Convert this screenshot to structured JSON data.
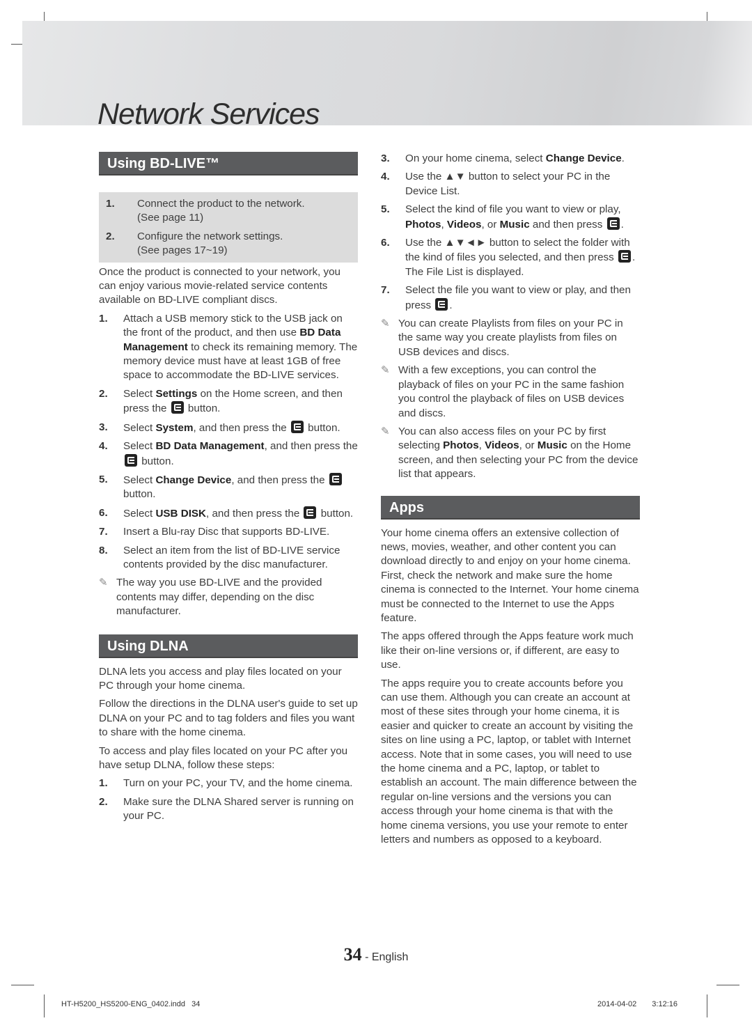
{
  "header": {
    "title": "Network Services"
  },
  "bdlive": {
    "heading": "Using BD-LIVE™",
    "prereq": [
      {
        "num": "1.",
        "text": "Connect the product to the network.",
        "sub": "(See page 11)"
      },
      {
        "num": "2.",
        "text": "Configure the network settings.",
        "sub": "(See pages 17~19)"
      }
    ],
    "intro": "Once the product is connected to your network, you can enjoy various movie-related service contents available on BD-LIVE compliant discs.",
    "steps": [
      {
        "num": "1.",
        "a": "Attach a USB memory stick to the USB jack on the front of the product, and then use ",
        "b": "BD Data Management",
        "c": " to check its remaining memory. The memory device must have at least 1GB of free space to accommodate the BD-LIVE services."
      },
      {
        "num": "2.",
        "a": "Select ",
        "b": "Settings",
        "c": " on the Home screen, and then press the ",
        "d": " button."
      },
      {
        "num": "3.",
        "a": "Select ",
        "b": "System",
        "c": ", and then press the ",
        "d": " button."
      },
      {
        "num": "4.",
        "a": "Select ",
        "b": "BD Data Management",
        "c": ", and then press the ",
        "d": " button."
      },
      {
        "num": "5.",
        "a": "Select ",
        "b": "Change Device",
        "c": ", and then press the ",
        "d": " button."
      },
      {
        "num": "6.",
        "a": "Select ",
        "b": "USB DISK",
        "c": ", and then press the ",
        "d": " button."
      },
      {
        "num": "7.",
        "a": "Insert a Blu-ray Disc that supports BD-LIVE."
      },
      {
        "num": "8.",
        "a": "Select an item from the list of BD-LIVE service contents provided by the disc manufacturer."
      }
    ],
    "note": "The way you use BD-LIVE and the provided contents may differ, depending on the disc manufacturer."
  },
  "dlna": {
    "heading": "Using DLNA",
    "paras": [
      "DLNA lets you access and play files located on your PC through your home cinema.",
      "Follow the directions in the DLNA user's guide to set up DLNA on your PC and to tag folders and files you want to share with the home cinema.",
      "To access and play files located on your PC after you have setup DLNA, follow these steps:"
    ],
    "steps": [
      {
        "num": "1.",
        "a": "Turn on your PC, your TV, and the home cinema."
      },
      {
        "num": "2.",
        "a": "Make sure the DLNA Shared server is running on your PC."
      },
      {
        "num": "3.",
        "a": "On your home cinema, select ",
        "b": "Change Device",
        "c": "."
      },
      {
        "num": "4.",
        "a": "Use the ▲▼ button to select your PC in the Device List."
      },
      {
        "num": "5.",
        "a": "Select the kind of file you want to view or play, ",
        "b1": "Photos",
        "s1": ", ",
        "b2": "Videos",
        "s2": ", or ",
        "b3": "Music",
        "c": " and then press "
      },
      {
        "num": "6.",
        "a": "Use the ▲▼◄► button to select the folder with the kind of files you selected, and then press ",
        "c": ". The File List is displayed."
      },
      {
        "num": "7.",
        "a": "Select the file you want to view or play, and then press ",
        "c": "."
      }
    ],
    "notes": [
      {
        "a": "You can create Playlists from files on your PC in the same way you create playlists from files on USB devices and discs."
      },
      {
        "a": "With a few exceptions, you can control the playback of files on your PC in the same fashion you control the playback of files on USB devices and discs."
      },
      {
        "a": "You can also access files on your PC by first selecting ",
        "b1": "Photos",
        "s1": ", ",
        "b2": "Videos",
        "s2": ", or ",
        "b3": "Music",
        "c": " on the Home screen, and then selecting your PC from the device list that appears."
      }
    ]
  },
  "apps": {
    "heading": "Apps",
    "paras": [
      "Your home cinema offers an extensive collection of news, movies, weather, and other content you can download directly to and enjoy on your home cinema. First, check the network and make sure the home cinema is connected to the Internet. Your home cinema must be connected to the Internet to use the Apps feature.",
      "The apps offered through the Apps feature work much like their on-line versions or, if different, are easy to use.",
      "The apps require you to create accounts before you can use them. Although you can create an account at most of these sites through your home cinema, it is easier and quicker to create an account by visiting the sites on line using a PC, laptop, or tablet with Internet access. Note that in some cases, you will need to use the home cinema and a PC, laptop, or tablet to establish an account. The main difference between the regular on-line versions and the versions you can access through your home cinema is that with the home cinema versions, you use your remote to enter letters and numbers as opposed to a keyboard."
    ]
  },
  "footer": {
    "page_number": "34",
    "page_lang": " - English",
    "file": "HT-H5200_HS5200-ENG_0402.indd   34",
    "date": "2014-04-02",
    "time": "3:12:16"
  },
  "icons": {
    "enter": "enter-button-icon",
    "note": "pencil-note-icon"
  }
}
